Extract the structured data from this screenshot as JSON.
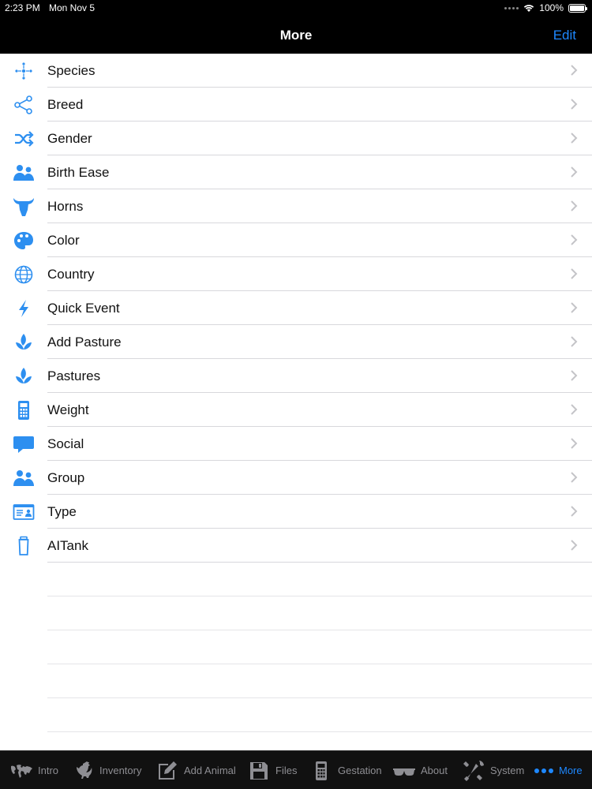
{
  "status": {
    "time": "2:23 PM",
    "date": "Mon Nov 5",
    "battery": "100%"
  },
  "nav": {
    "title": "More",
    "edit_label": "Edit"
  },
  "items": [
    {
      "label": "Species",
      "icon": "species-icon"
    },
    {
      "label": "Breed",
      "icon": "share-nodes-icon"
    },
    {
      "label": "Gender",
      "icon": "shuffle-icon"
    },
    {
      "label": "Birth Ease",
      "icon": "users-icon"
    },
    {
      "label": "Horns",
      "icon": "bull-head-icon"
    },
    {
      "label": "Color",
      "icon": "palette-icon"
    },
    {
      "label": "Country",
      "icon": "globe-icon"
    },
    {
      "label": "Quick Event",
      "icon": "lightning-icon"
    },
    {
      "label": "Add Pasture",
      "icon": "leaf-icon"
    },
    {
      "label": "Pastures",
      "icon": "leaf-icon"
    },
    {
      "label": "Weight",
      "icon": "calculator-icon"
    },
    {
      "label": "Social",
      "icon": "speech-bubble-icon"
    },
    {
      "label": "Group",
      "icon": "users-icon"
    },
    {
      "label": "Type",
      "icon": "id-card-icon"
    },
    {
      "label": "AITank",
      "icon": "tank-icon"
    }
  ],
  "tabs": [
    {
      "label": "Intro",
      "icon": "world-map-icon"
    },
    {
      "label": "Inventory",
      "icon": "rooster-icon"
    },
    {
      "label": "Add Animal",
      "icon": "edit-icon"
    },
    {
      "label": "Files",
      "icon": "floppy-disk-icon"
    },
    {
      "label": "Gestation",
      "icon": "calculator-icon"
    },
    {
      "label": "About",
      "icon": "glasses-icon"
    },
    {
      "label": "System",
      "icon": "tools-icon"
    },
    {
      "label": "More",
      "icon": "more-dots-icon",
      "active": true
    }
  ],
  "colors": {
    "accent": "#1e88ff",
    "icon": "#2d8ff0",
    "tab_inactive": "#8e8e93"
  }
}
